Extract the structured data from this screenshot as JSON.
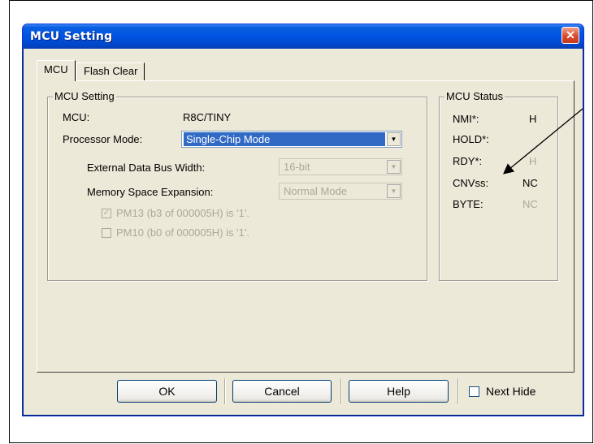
{
  "dialog": {
    "title": "MCU Setting"
  },
  "tabs": [
    {
      "label": "MCU",
      "active": true
    },
    {
      "label": "Flash Clear",
      "active": false
    }
  ],
  "mcu_setting": {
    "group_label": "MCU Setting",
    "mcu_label": "MCU:",
    "mcu_value": "R8C/TINY",
    "processor_mode_label": "Processor Mode:",
    "processor_mode_value": "Single-Chip Mode",
    "ext_bus_label": "External Data Bus Width:",
    "ext_bus_value": "16-bit",
    "mem_exp_label": "Memory Space Expansion:",
    "mem_exp_value": "Normal Mode",
    "pm13_label": "PM13 (b3 of 000005H) is '1'.",
    "pm13_checked": true,
    "pm10_label": "PM10 (b0 of 000005H) is '1'.",
    "pm10_checked": false
  },
  "mcu_status": {
    "group_label": "MCU Status",
    "rows": [
      {
        "name": "NMI*:",
        "value": "H",
        "enabled": true
      },
      {
        "name": "HOLD*:",
        "value": "",
        "enabled": true
      },
      {
        "name": "RDY*:",
        "value": "H",
        "enabled": false
      },
      {
        "name": "CNVss:",
        "value": "NC",
        "enabled": true
      },
      {
        "name": "BYTE:",
        "value": "NC",
        "enabled": false
      }
    ]
  },
  "buttons": {
    "ok": "OK",
    "cancel": "Cancel",
    "help": "Help",
    "next_hide": "Next Hide"
  },
  "colors": {
    "titlebar": "#0053e1",
    "selection": "#316ac5",
    "disabled_text": "#aca899",
    "face": "#ece9d8"
  }
}
